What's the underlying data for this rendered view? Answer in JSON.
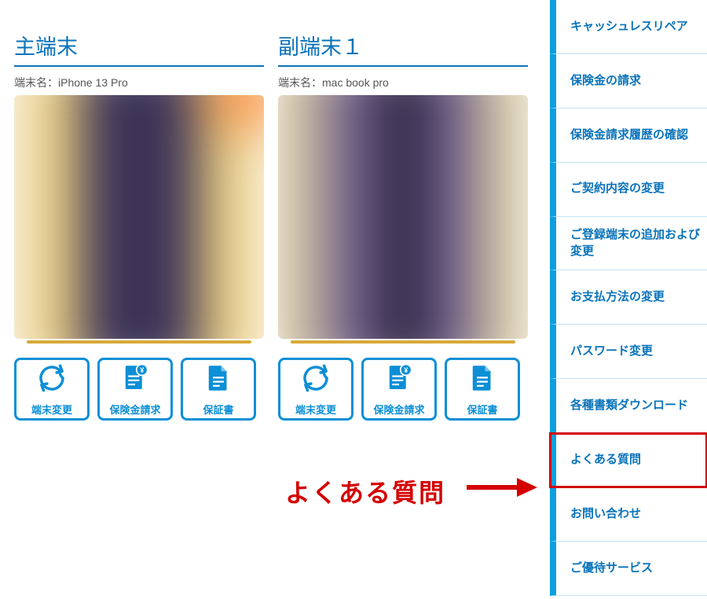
{
  "cards": [
    {
      "title": "主端末",
      "device_label_prefix": "端末名：",
      "device_name": "iPhone 13 Pro",
      "blur_variant": "gold",
      "actions": [
        {
          "label": "端末変更",
          "icon": "refresh"
        },
        {
          "label": "保険金請求",
          "icon": "claim"
        },
        {
          "label": "保証書",
          "icon": "document"
        }
      ]
    },
    {
      "title": "副端末１",
      "device_label_prefix": "端末名：",
      "device_name": "mac book pro",
      "blur_variant": "dark",
      "actions": [
        {
          "label": "端末変更",
          "icon": "refresh"
        },
        {
          "label": "保険金請求",
          "icon": "claim"
        },
        {
          "label": "保証書",
          "icon": "document"
        }
      ]
    }
  ],
  "annotation": {
    "text": "よくある質問",
    "target_index": 8
  },
  "sidebar": {
    "items": [
      "キャッシュレスリペア",
      "保険金の請求",
      "保険金請求履歴の確認",
      "ご契約内容の変更",
      "ご登録端末の追加および変更",
      "お支払方法の変更",
      "パスワード変更",
      "各種書類ダウンロード",
      "よくある質問",
      "お問い合わせ",
      "ご優待サービス"
    ]
  },
  "colors": {
    "brand_blue": "#0a73ba",
    "icon_blue": "#0d8fd6",
    "accent_red": "#d40000",
    "sidebar_stripe": "#0d9fe0"
  }
}
